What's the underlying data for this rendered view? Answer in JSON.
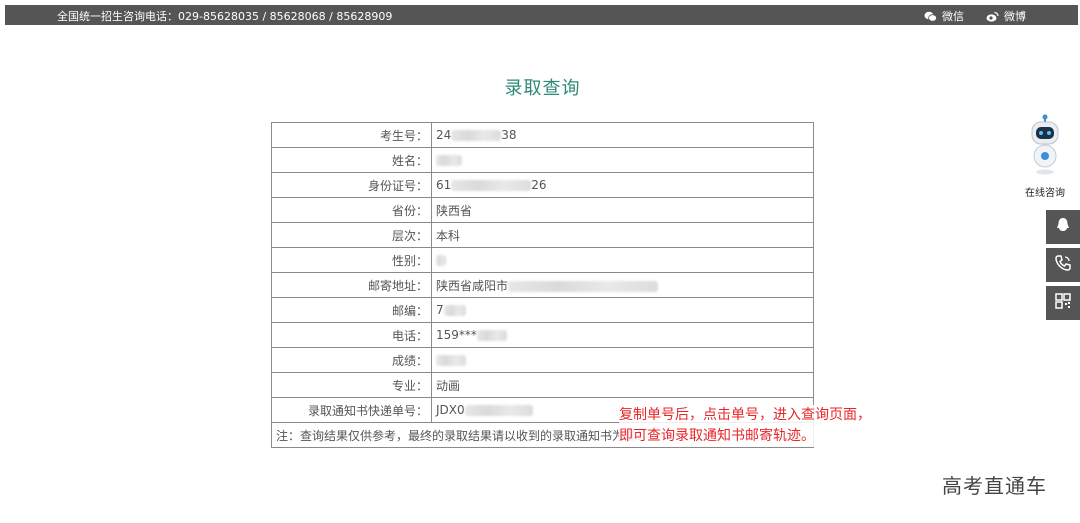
{
  "topbar": {
    "hotline": "全国统一招生咨询电话：029-85628035 / 85628068 / 85628909",
    "wechat": "微信",
    "weibo": "微博"
  },
  "page_title": "录取查询",
  "rows": [
    {
      "label": "考生号：",
      "value": "24",
      "tail": "38"
    },
    {
      "label": "姓名：",
      "value": "",
      "tail": ""
    },
    {
      "label": "身份证号：",
      "value": "61",
      "tail": "26"
    },
    {
      "label": "省份：",
      "value": "陕西省",
      "tail": ""
    },
    {
      "label": "层次：",
      "value": "本科",
      "tail": ""
    },
    {
      "label": "性别：",
      "value": "",
      "tail": ""
    },
    {
      "label": "邮寄地址：",
      "value": "陕西省咸阳市",
      "tail": ""
    },
    {
      "label": "邮编：",
      "value": "7",
      "tail": ""
    },
    {
      "label": "电话：",
      "value": "159***",
      "tail": ""
    },
    {
      "label": "成绩：",
      "value": "",
      "tail": ""
    },
    {
      "label": "专业：",
      "value": "动画",
      "tail": ""
    },
    {
      "label": "录取通知书快递单号：",
      "value": "JDX0",
      "tail": ""
    }
  ],
  "note": "注：查询结果仅供参考，最终的录取结果请以收到的录取通知书为准！",
  "annotation": {
    "line1": "复制单号后，点击单号，进入查询页面，",
    "line2": "即可查询录取通知书邮寄轨迹。"
  },
  "sidebar": {
    "robot_label": "在线咨询"
  },
  "watermark": "高考直通车",
  "colors": {
    "topbar": "#555555",
    "title": "#2e8a78",
    "annotation": "#e8262a"
  }
}
